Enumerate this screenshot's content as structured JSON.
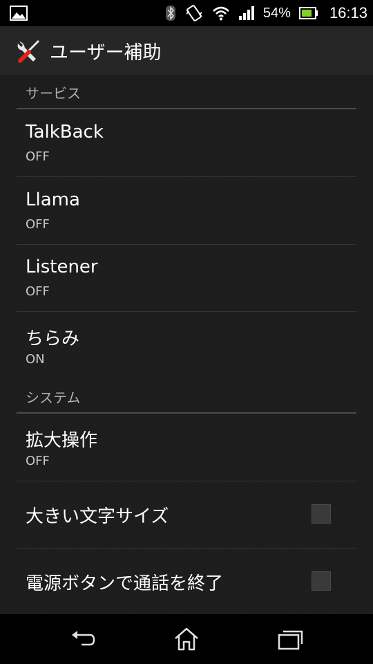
{
  "status_bar": {
    "battery_percent": "54%",
    "time": "16:13",
    "icons": [
      "image-notification-icon",
      "bluetooth-icon",
      "vibrate-icon",
      "wifi-icon",
      "signal-icon",
      "battery-icon"
    ]
  },
  "action_bar": {
    "title": "ユーザー補助",
    "icon": "accessibility-tools-icon"
  },
  "sections": [
    {
      "header": "サービス",
      "items": [
        {
          "title": "TalkBack",
          "summary": "OFF"
        },
        {
          "title": "Llama",
          "summary": "OFF"
        },
        {
          "title": "Listener",
          "summary": "OFF"
        },
        {
          "title": "ちらみ",
          "summary": "ON"
        }
      ]
    },
    {
      "header": "システム",
      "items": [
        {
          "title": "拡大操作",
          "summary": "OFF"
        },
        {
          "title": "大きい文字サイズ",
          "checked": false
        },
        {
          "title": "電源ボタンで通話を終了",
          "checked": false
        }
      ]
    }
  ],
  "nav_bar": {
    "icons": [
      "back-icon",
      "home-icon",
      "recent-apps-icon"
    ]
  },
  "colors": {
    "background": "#1c1c1c",
    "action_bar": "#262626",
    "battery_green": "#7ed321"
  }
}
